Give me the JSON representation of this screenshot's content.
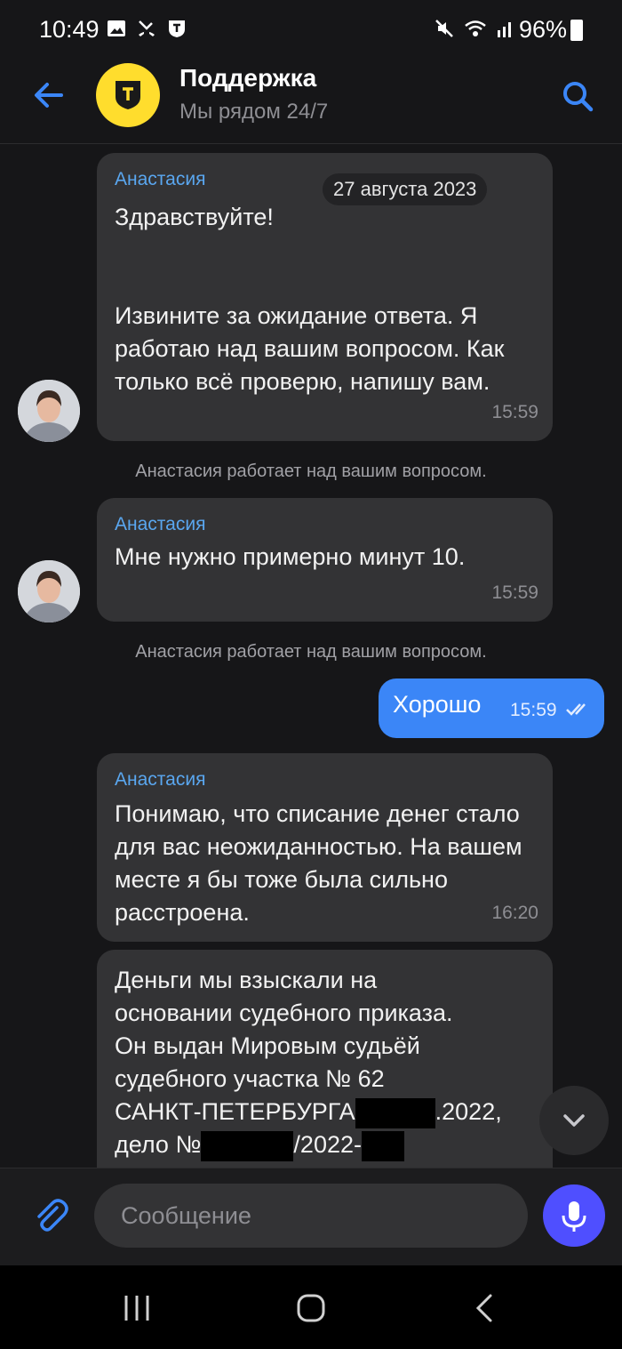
{
  "status_bar": {
    "time": "10:49",
    "battery": "96%"
  },
  "header": {
    "title": "Поддержка",
    "subtitle": "Мы рядом 24/7"
  },
  "messages": {
    "m1": {
      "sender": "Анастасия",
      "date": "27 августа 2023",
      "text": "Здравствуйте!\n\n\nИзвините за ожидание ответа. Я работаю над вашим вопросом. Как только всё проверю, напишу вам.",
      "time": "15:59"
    },
    "sys1": "Анастасия работает над вашим вопросом.",
    "m2": {
      "sender": "Анастасия",
      "text": "Мне нужно примерно минут 10.",
      "time": "15:59"
    },
    "sys2": "Анастасия работает над вашим вопросом.",
    "out1": {
      "text": "Хорошо",
      "time": "15:59"
    },
    "m3": {
      "sender": "Анастасия",
      "text": "Понимаю, что списание денег стало для вас неожиданностью. На вашем месте я бы тоже была сильно расстроена.",
      "time": "16:20"
    },
    "m4": {
      "line1": "Деньги мы взыскали на",
      "line2": "основании судебного приказа.",
      "line3": "Он выдан Мировым судьёй",
      "line4": "судебного участка № 62",
      "line5_a": "САНКТ-ПЕТЕРБУРГА",
      "line5_b": ".2022,",
      "line6_a": "дело №",
      "line6_b": "/2022-"
    }
  },
  "composer": {
    "placeholder": "Сообщение"
  },
  "colors": {
    "accent": "#3b86f7",
    "bubble": "#333335",
    "background": "#161618",
    "logo": "#ffdd2d"
  }
}
